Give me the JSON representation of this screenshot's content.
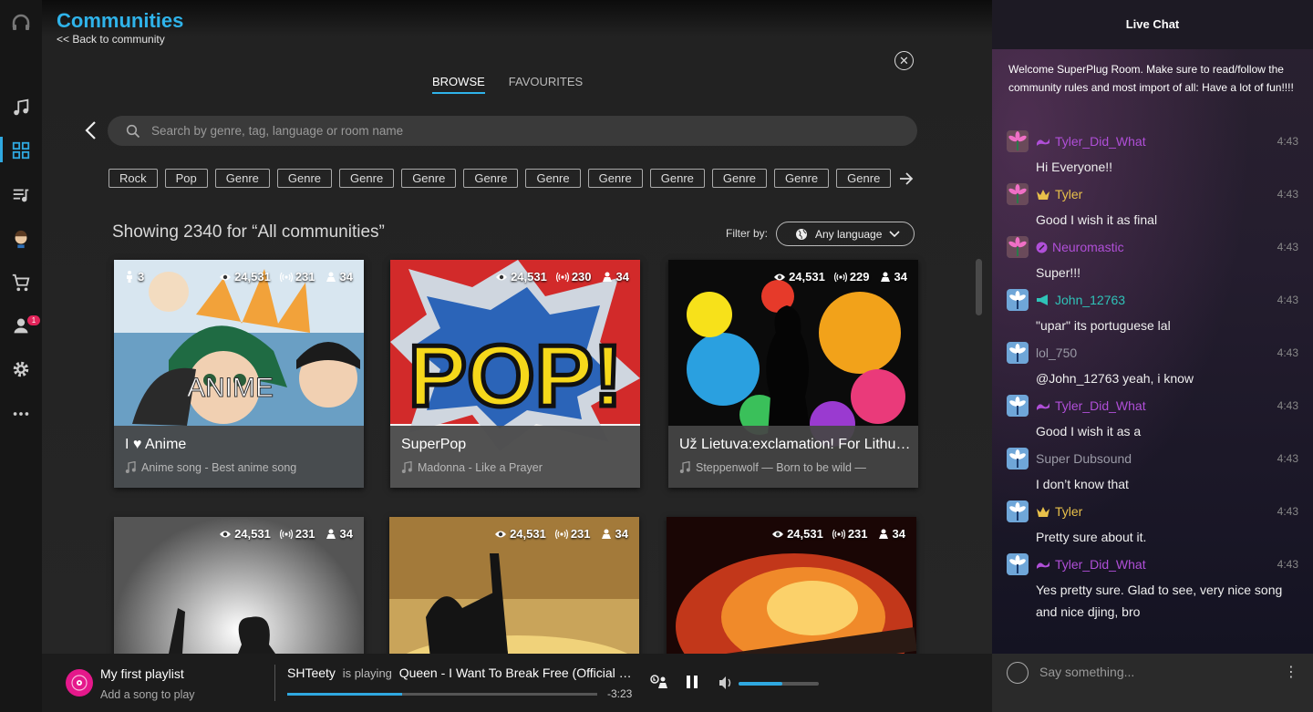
{
  "page": {
    "title": "Communities",
    "back_link": "<< Back to community"
  },
  "tabs": [
    {
      "label": "BROWSE",
      "active": true
    },
    {
      "label": "FAVOURITES",
      "active": false
    }
  ],
  "search": {
    "placeholder": "Search by genre, tag, language or room name"
  },
  "chips": [
    "Rock",
    "Pop",
    "Genre",
    "Genre",
    "Genre",
    "Genre",
    "Genre",
    "Genre",
    "Genre",
    "Genre",
    "Genre",
    "Genre",
    "Genre"
  ],
  "results": {
    "summary": "Showing 2340 for “All communities”",
    "filter_label": "Filter by:",
    "filter_value": "Any language"
  },
  "cards": [
    {
      "name": "I ♥ Anime",
      "song": "Anime song - Best anime song",
      "people": "3",
      "views": "24,531",
      "live": "231",
      "djs": "34",
      "theme": "anime"
    },
    {
      "name": "SuperPop",
      "song": "Madonna - Like a Prayer",
      "people": "",
      "views": "24,531",
      "live": "230",
      "djs": "34",
      "theme": "pop"
    },
    {
      "name": "Už Lietuva:exclamation! For Lithua…",
      "song": "Steppenwolf — Born to be wild —",
      "people": "",
      "views": "24,531",
      "live": "229",
      "djs": "34",
      "theme": "splash"
    },
    {
      "name": "",
      "song": "",
      "people": "",
      "views": "24,531",
      "live": "231",
      "djs": "34",
      "theme": "rock"
    },
    {
      "name": "",
      "song": "",
      "people": "",
      "views": "24,531",
      "live": "231",
      "djs": "34",
      "theme": "sunset"
    },
    {
      "name": "",
      "song": "",
      "people": "",
      "views": "24,531",
      "live": "231",
      "djs": "34",
      "theme": "fire"
    }
  ],
  "player": {
    "playlist": "My first playlist",
    "add_song": "Add a song to play",
    "dj": "SHTeety",
    "is_playing": "is playing",
    "track": "Queen - I Want To Break Free (Official vide...",
    "time_left": "-3:23",
    "progress": 0.37,
    "volume": 0.55
  },
  "chat": {
    "title": "Live Chat",
    "welcome": "Welcome SuperPlug Room. Make sure to read/follow the community rules and most import of all: Have a lot of  fun!!!!",
    "input_placeholder": "Say something...",
    "messages": [
      {
        "user": "Tyler_Did_What",
        "badge": "wave",
        "color": "#b04fd8",
        "time": "4:43",
        "text": "Hi Everyone!!",
        "avatar": "flower"
      },
      {
        "user": "Tyler",
        "badge": "crown",
        "color": "#e8c04a",
        "time": "4:43",
        "text": "Good I wish it as final",
        "avatar": "flower"
      },
      {
        "user": "Neuromastic",
        "badge": "disc",
        "color": "#b04fd8",
        "time": "4:43",
        "text": "Super!!!",
        "avatar": "flower"
      },
      {
        "user": "John_12763",
        "badge": "megaphone",
        "color": "#2fc3b8",
        "time": "4:43",
        "text": "\"upar\" its portuguese lal",
        "avatar": "blue"
      },
      {
        "user": "lol_750",
        "badge": "",
        "color": "#9a9aa6",
        "time": "4:43",
        "text": "@John_12763 yeah, i know",
        "avatar": "blue"
      },
      {
        "user": "Tyler_Did_What",
        "badge": "wave",
        "color": "#b04fd8",
        "time": "4:43",
        "text": "Good I wish it as a",
        "avatar": "blue"
      },
      {
        "user": "Super Dubsound",
        "badge": "",
        "color": "#9a9aa6",
        "time": "4:43",
        "text": "I don’t know that",
        "avatar": "blue"
      },
      {
        "user": "Tyler",
        "badge": "crown",
        "color": "#e8c04a",
        "time": "4:43",
        "text": "Pretty sure about it.",
        "avatar": "blue"
      },
      {
        "user": "Tyler_Did_What",
        "badge": "wave",
        "color": "#b04fd8",
        "time": "4:43",
        "text": "Yes pretty sure.  Glad to see, very nice song and nice djing, bro",
        "avatar": "blue"
      }
    ]
  },
  "rail": {
    "notification_count": "1"
  },
  "colors": {
    "accent": "#2fb3ea",
    "progress": "#2fa8e0",
    "playlist_icon": "#e5188b"
  }
}
